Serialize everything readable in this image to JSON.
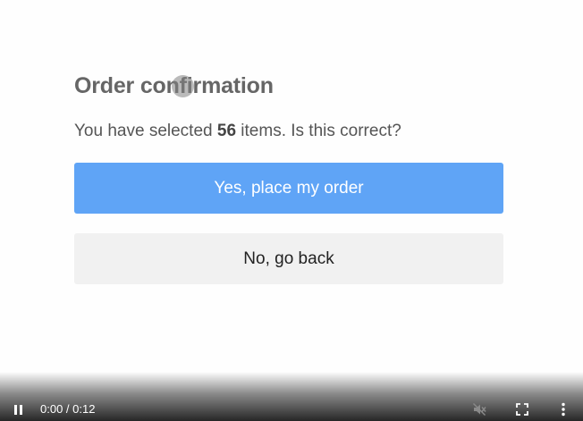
{
  "dialog": {
    "title": "Order confirmation",
    "message_prefix": "You have selected ",
    "item_count": "56",
    "message_suffix": " items. Is this correct?",
    "confirm_label": "Yes, place my order",
    "cancel_label": "No, go back"
  },
  "video_controls": {
    "time_display": "0:00 / 0:12"
  },
  "icons": {
    "pause": "pause-icon",
    "mute": "muted-speaker-icon",
    "fullscreen": "fullscreen-icon",
    "more": "more-vertical-icon"
  },
  "colors": {
    "primary_button": "#5fa4f6",
    "secondary_button": "#f1f1f1",
    "title_text": "#666666"
  }
}
